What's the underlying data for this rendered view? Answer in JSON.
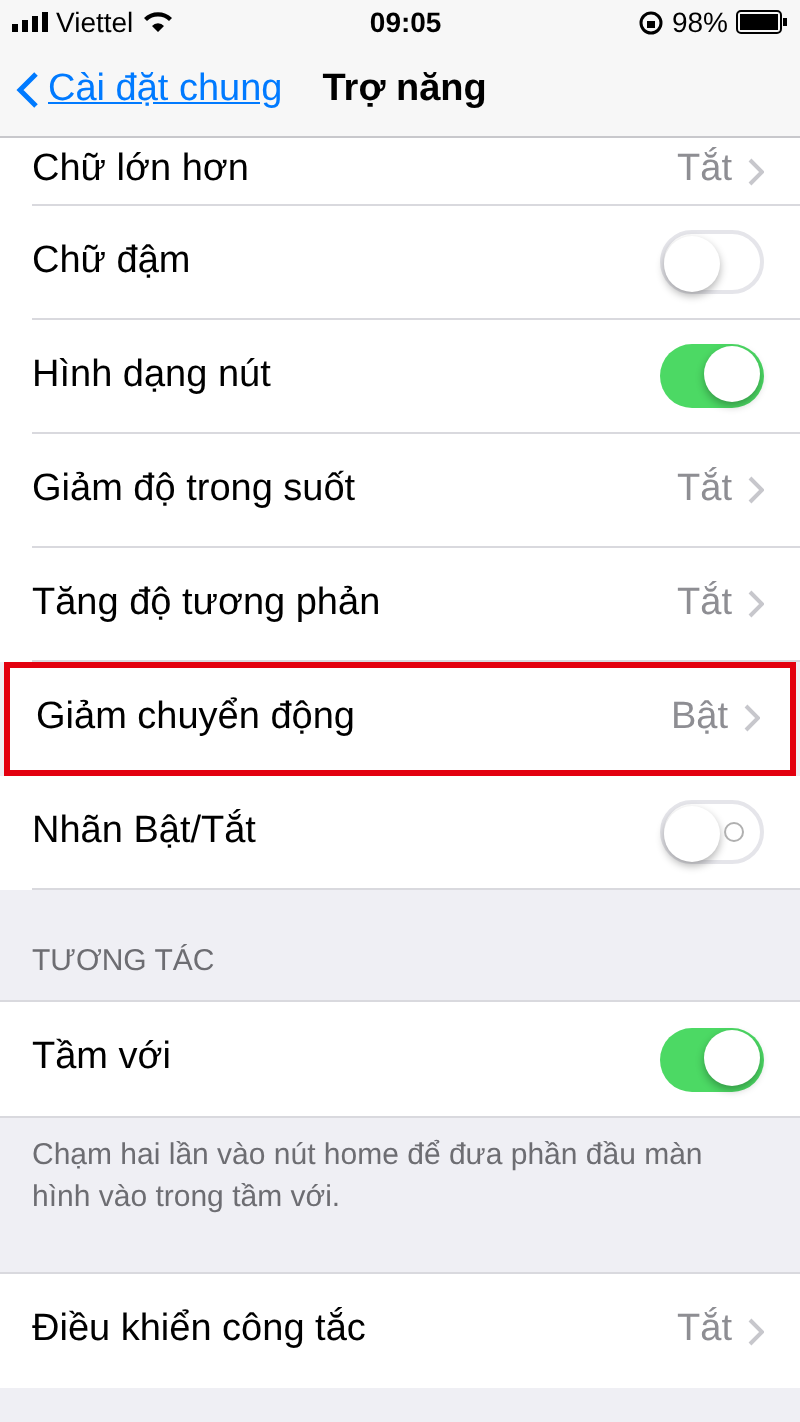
{
  "status_bar": {
    "carrier": "Viettel",
    "time": "09:05",
    "battery": "98%"
  },
  "nav": {
    "back": "Cài đặt chung",
    "title": "Trợ năng"
  },
  "rows": [
    {
      "kind": "value",
      "label": "Chữ lớn hơn",
      "value": "Tắt",
      "highlighted": false
    },
    {
      "kind": "switch",
      "label": "Chữ đậm",
      "on": false,
      "highlighted": false
    },
    {
      "kind": "switch",
      "label": "Hình dạng nút",
      "on": true,
      "highlighted": false
    },
    {
      "kind": "value",
      "label": "Giảm độ trong suốt",
      "value": "Tắt",
      "highlighted": false
    },
    {
      "kind": "value",
      "label": "Tăng độ tương phản",
      "value": "Tắt",
      "highlighted": false
    },
    {
      "kind": "value",
      "label": "Giảm chuyển động",
      "value": "Bật",
      "highlighted": true
    },
    {
      "kind": "switch",
      "label": "Nhãn Bật/Tắt",
      "on": false,
      "labels_shown": true,
      "highlighted": false
    }
  ],
  "interaction": {
    "header": "TƯƠNG TÁC",
    "rows": [
      {
        "kind": "switch",
        "label": "Tầm với",
        "on": true,
        "highlighted": false
      }
    ],
    "footer": "Chạm hai lần vào nút home để đưa phần đầu màn hình vào trong tầm với."
  },
  "last_rows": [
    {
      "kind": "value",
      "label": "Điều khiển công tắc",
      "value": "Tắt",
      "highlighted": false
    }
  ]
}
